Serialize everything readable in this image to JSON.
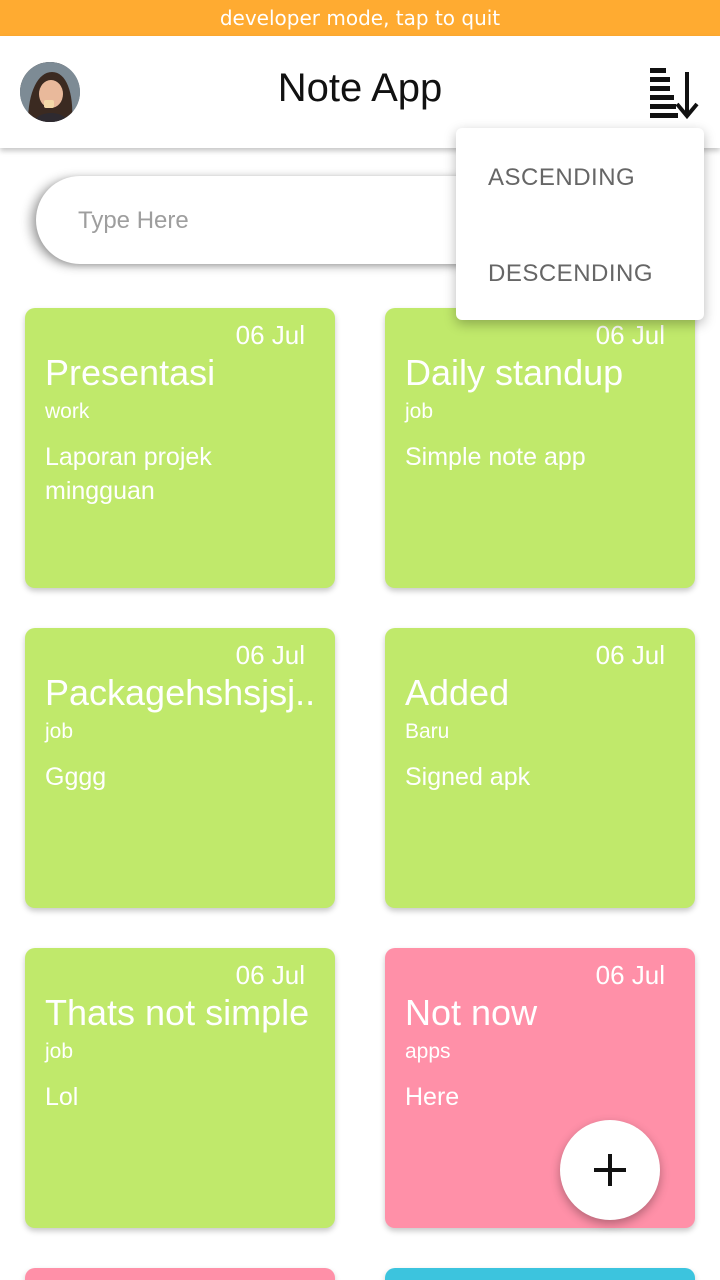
{
  "dev_banner": "developer mode, tap to quit",
  "app_title": "Note App",
  "search": {
    "placeholder": "Type Here"
  },
  "sort_menu": {
    "ascending": "ASCENDING",
    "descending": "DESCENDING"
  },
  "notes": [
    {
      "date": "06 Jul",
      "title": "Presentasi",
      "tag": "work",
      "body": "Laporan projek mingguan",
      "color": "#C0E96B"
    },
    {
      "date": "06 Jul",
      "title": "Daily standup",
      "tag": "job",
      "body": "Simple note app",
      "color": "#C0E96B"
    },
    {
      "date": "06 Jul",
      "title": "Packagehshsjsj..",
      "tag": "job",
      "body": "Gggg",
      "color": "#C0E96B"
    },
    {
      "date": "06 Jul",
      "title": "Added",
      "tag": "Baru",
      "body": "Signed apk",
      "color": "#C0E96B"
    },
    {
      "date": "06 Jul",
      "title": "Thats not simple",
      "tag": "job",
      "body": "Lol",
      "color": "#C0E96B"
    },
    {
      "date": "06 Jul",
      "title": "Not now",
      "tag": "apps",
      "body": "Here",
      "color": "#FF90A8"
    }
  ],
  "partial_cards": [
    {
      "color": "#FF90A8"
    },
    {
      "color": "#3CC4DE"
    }
  ],
  "icons": {
    "sort": "sort-descending-icon",
    "add": "plus-icon",
    "avatar": "user-avatar"
  },
  "colors": {
    "dev_banner": "#FFA726",
    "fab": "#ffffff"
  }
}
